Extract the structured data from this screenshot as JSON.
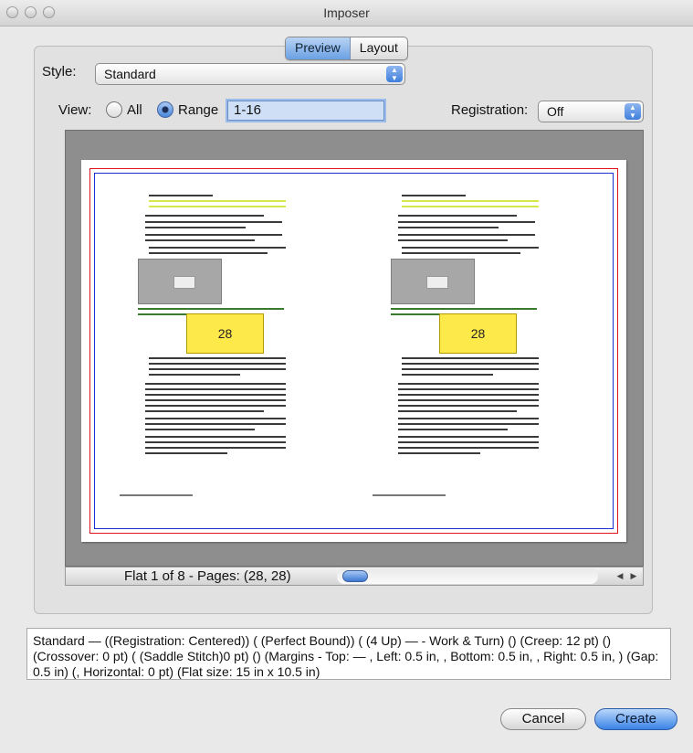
{
  "window": {
    "title": "Imposer"
  },
  "tabs": [
    {
      "label": "Preview",
      "active": true
    },
    {
      "label": "Layout",
      "active": false
    }
  ],
  "style": {
    "label": "Style:",
    "value": "Standard"
  },
  "view": {
    "label": "View:",
    "options": [
      {
        "label": "All",
        "selected": false
      },
      {
        "label": "Range",
        "selected": true
      }
    ],
    "range_value": "1-16"
  },
  "registration": {
    "label": "Registration:",
    "value": "Off"
  },
  "preview": {
    "left_page_number": "28",
    "right_page_number": "28",
    "status": "Flat 1 of 8 - Pages: (28, 28)"
  },
  "summary": "Standard — ((Registration: Centered)) ( (Perfect Bound)) ( (4 Up) — - Work & Turn) () (Creep: 12 pt) () (Crossover: 0 pt) ( (Saddle Stitch)0 pt) () (Margins - Top: — , Left: 0.5 in, , Bottom: 0.5 in, , Right: 0.5 in, ) (Gap: 0.5 in) (, Horizontal: 0 pt) (Flat size: 15 in x 10.5 in)",
  "buttons": {
    "cancel": "Cancel",
    "create": "Create"
  },
  "colors": {
    "accent": "#3b83e6",
    "page_label_bg": "#fde94a",
    "bleed_frame": "#e0141e",
    "trim_frame": "#1931d4"
  }
}
